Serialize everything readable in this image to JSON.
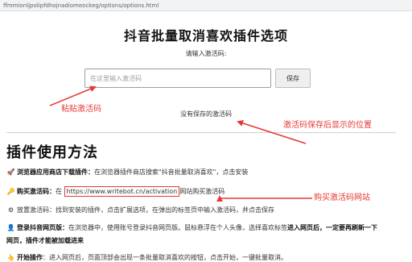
{
  "browser": {
    "url": "ffmmionljpolipfdhojnadiomeockeg/options/options.html"
  },
  "header": {
    "title": "抖音批量取消喜欢插件选项",
    "prompt": "请输入激活码:"
  },
  "activation": {
    "placeholder": "在这里输入激活码",
    "value": "",
    "save_label": "保存",
    "status": "没有保存的激活码"
  },
  "annotations": {
    "paste_note": "粘贴激活码",
    "saved_note": "激活码保存后显示的位置",
    "buy_note": "购买激活码网站",
    "color": "#e53935"
  },
  "usage": {
    "title": "插件使用方法",
    "steps": [
      {
        "icon": "rocket-icon",
        "glyph": "🚀",
        "label": "浏览器应用商店下载插件：",
        "text": "在浏览器插件商店搜索\"抖音批量取消喜欢\"，点击安装"
      },
      {
        "icon": "key-icon",
        "glyph": "🔑",
        "label": "购买激活码：",
        "pre": "在",
        "link": "https://www.writebot.cn/activation",
        "post": "网站购买激活码"
      },
      {
        "icon": "gear-icon",
        "glyph": "⚙",
        "label": "",
        "text": "放置激活码：找到安装的插件，点击扩展选项，在弹出的标签页中输入激活码，并点击保存"
      },
      {
        "icon": "person-icon",
        "glyph": "👤",
        "label": "登录抖音网页版：",
        "text": "在浏览器中，使用账号登录抖音网页版。鼠标悬浮在个人头像，选择喜欢标签",
        "bold": "进入网页后，一定要再刷新一下",
        "cont": "网页，插件才能被加载进来"
      },
      {
        "icon": "click-icon",
        "glyph": "👆",
        "label": "开始操作",
        "text": "：进入网页后，页面顶部会出现一条批量取消喜欢的按钮，点击开始，一键批量取消。"
      }
    ]
  }
}
